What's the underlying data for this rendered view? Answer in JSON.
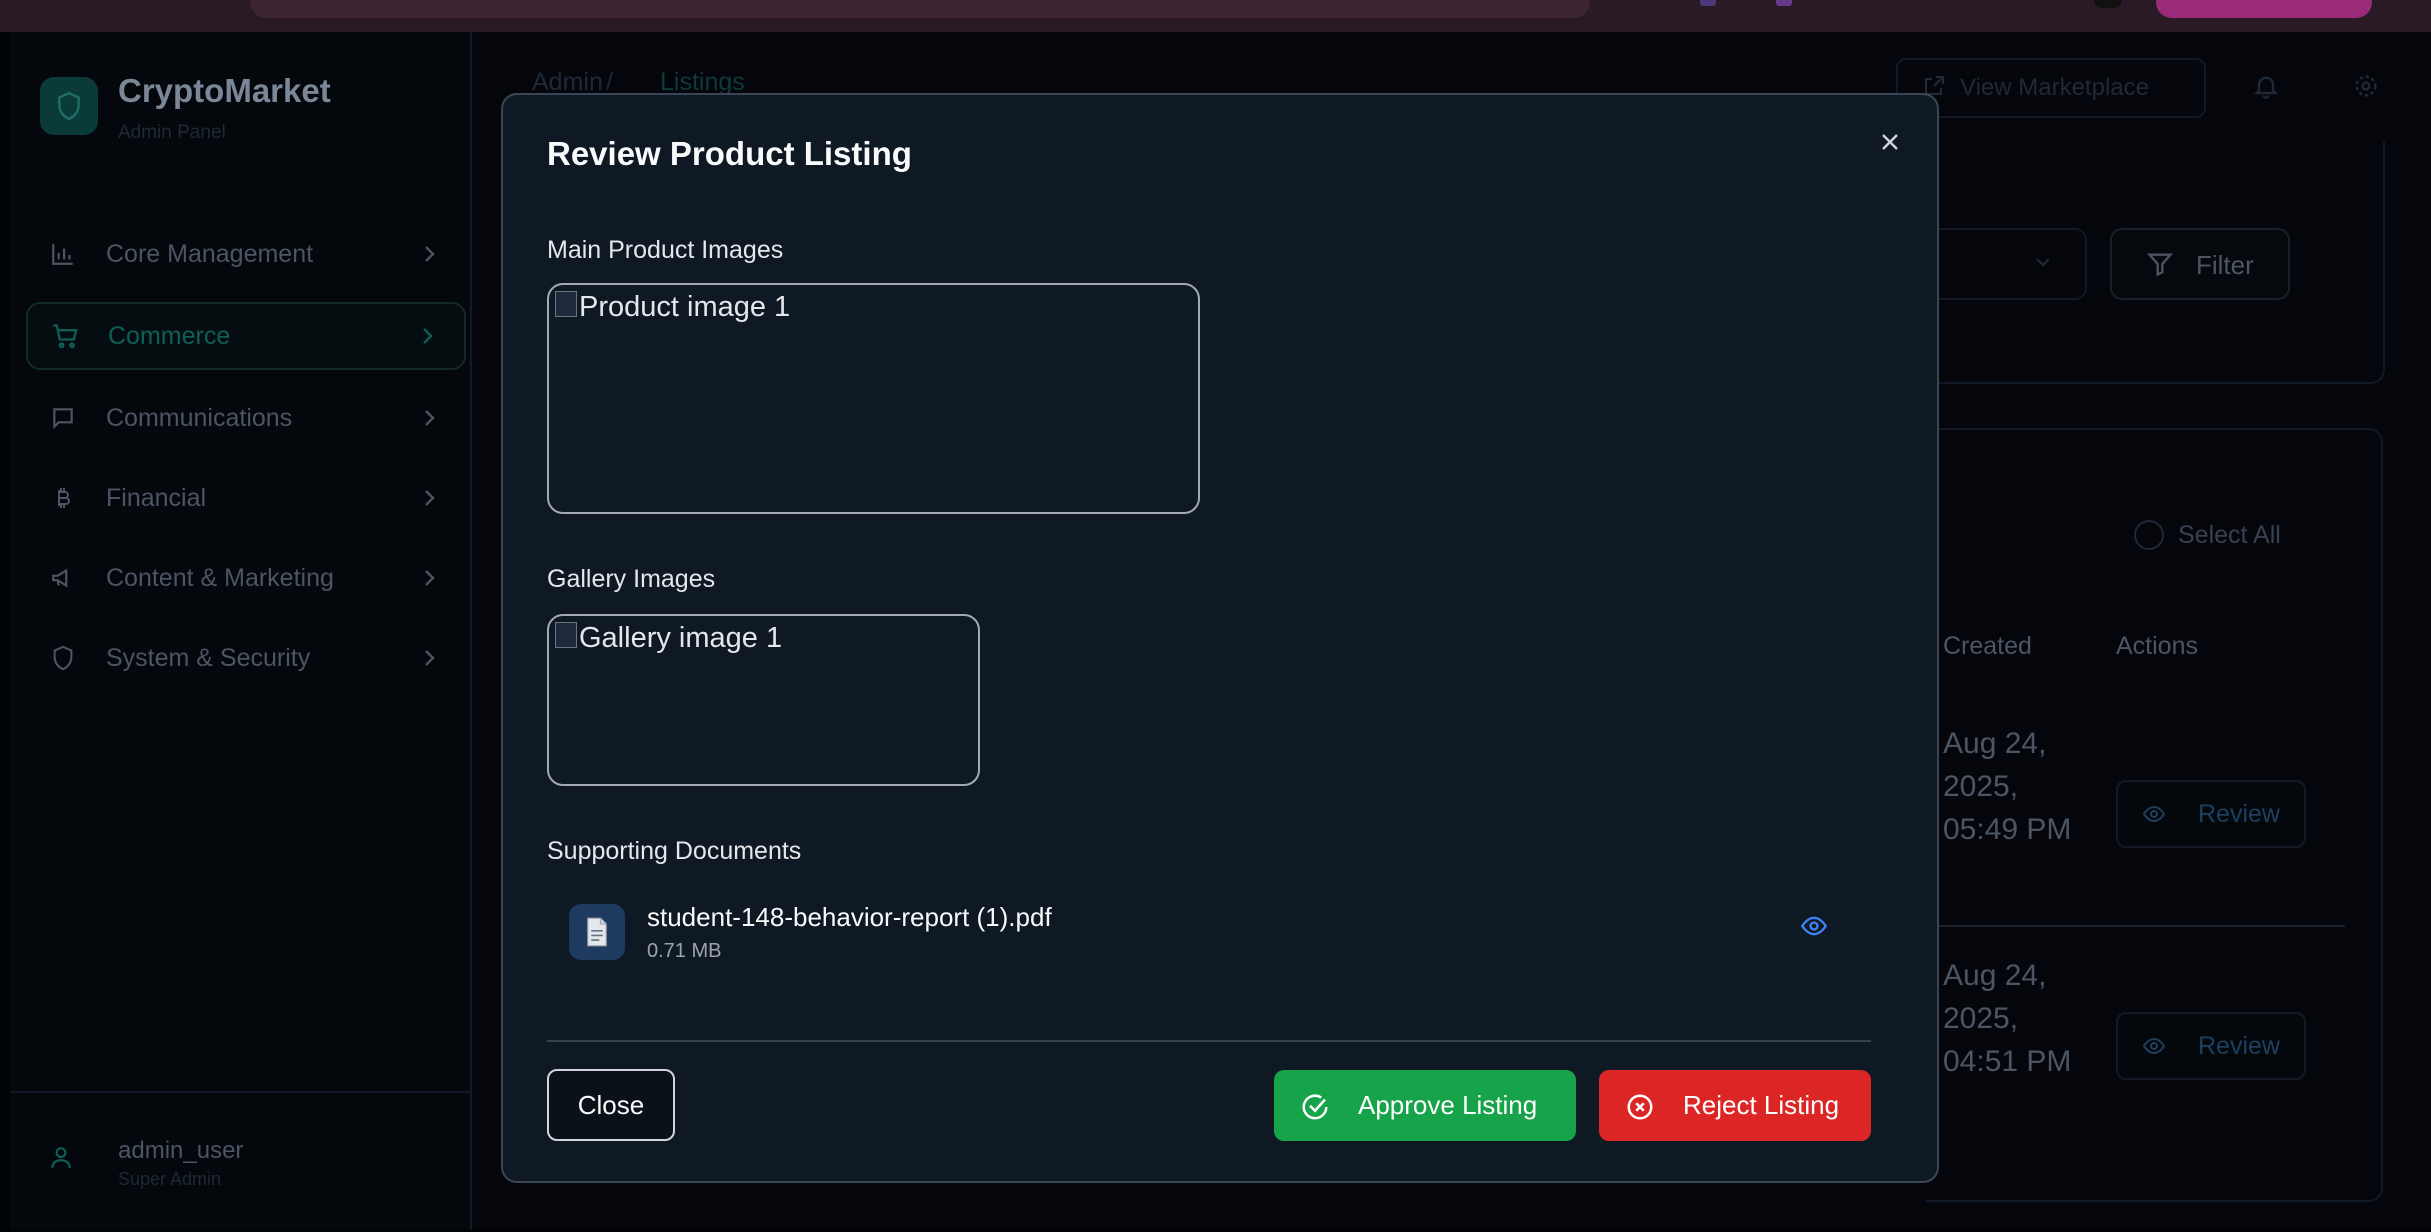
{
  "app": {
    "brand_name": "CryptoMarket",
    "brand_sub": "Admin Panel"
  },
  "sidebar": {
    "items": [
      {
        "label": "Core Management",
        "icon": "bar-chart-icon"
      },
      {
        "label": "Commerce",
        "icon": "cart-icon",
        "active": true
      },
      {
        "label": "Communications",
        "icon": "chat-icon"
      },
      {
        "label": "Financial",
        "icon": "bitcoin-icon"
      },
      {
        "label": "Content & Marketing",
        "icon": "megaphone-icon"
      },
      {
        "label": "System & Security",
        "icon": "shield-icon"
      }
    ],
    "user": {
      "name": "admin_user",
      "role": "Super Admin"
    }
  },
  "header": {
    "breadcrumb": [
      "Admin",
      "/",
      "Listings"
    ],
    "view_marketplace": "View Marketplace"
  },
  "background": {
    "filter_label": "Filter",
    "select_all": "Select All",
    "columns": {
      "created": "Created",
      "actions": "Actions"
    },
    "rows": [
      {
        "created": "Aug 24, 2025, 05:49 PM",
        "action": "Review"
      },
      {
        "created": "Aug 24, 2025, 04:51 PM",
        "action": "Review"
      }
    ]
  },
  "modal": {
    "title": "Review Product Listing",
    "main_images_label": "Main Product Images",
    "main_image_alt": "Product image 1",
    "gallery_label": "Gallery Images",
    "gallery_image_alt": "Gallery image 1",
    "documents_label": "Supporting Documents",
    "document": {
      "name": "student-148-behavior-report (1).pdf",
      "size": "0.71 MB",
      "icon": "document-icon"
    },
    "close_label": "Close",
    "approve_label": "Approve Listing",
    "reject_label": "Reject Listing"
  },
  "colors": {
    "modal_bg": "#0f1923",
    "approve": "#16a34a",
    "reject": "#dc2626",
    "accent_teal": "#0f5e58",
    "eye_blue": "#3b82f6"
  }
}
